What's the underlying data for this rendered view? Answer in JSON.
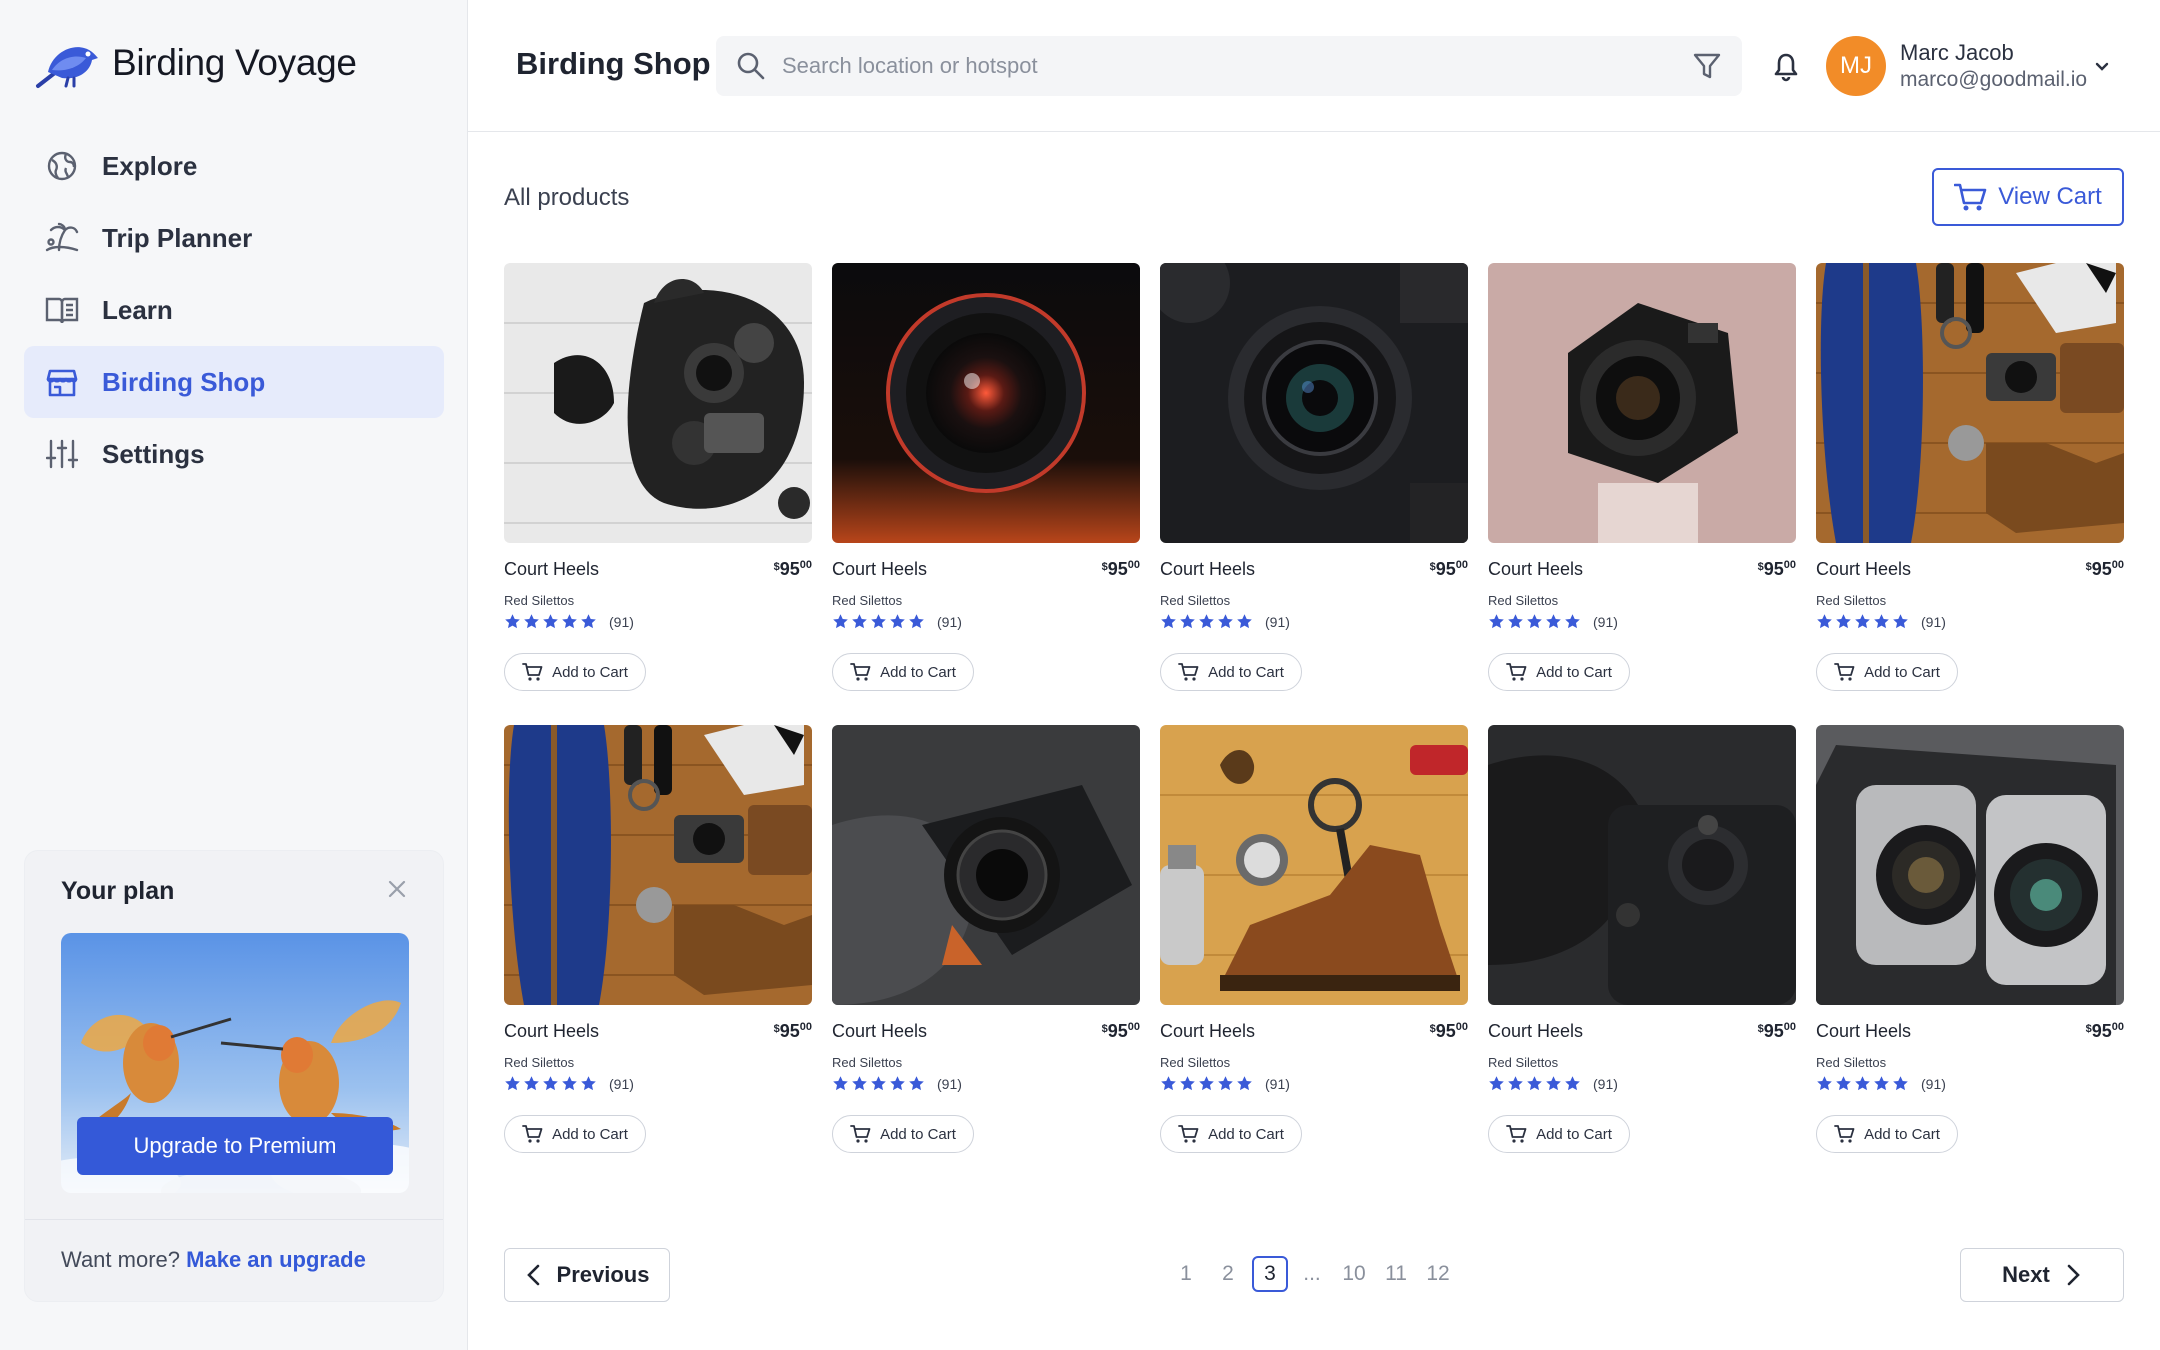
{
  "app": {
    "name": "Birding Voyage"
  },
  "sidebar": {
    "items": [
      {
        "label": "Explore",
        "icon": "globe-icon",
        "active": false
      },
      {
        "label": "Trip Planner",
        "icon": "island-icon",
        "active": false
      },
      {
        "label": "Learn",
        "icon": "book-icon",
        "active": false
      },
      {
        "label": "Birding Shop",
        "icon": "store-icon",
        "active": true
      },
      {
        "label": "Settings",
        "icon": "sliders-icon",
        "active": false
      }
    ],
    "plan": {
      "title": "Your plan",
      "upgrade_label": "Upgrade to  Premium",
      "more_text": "Want more?",
      "more_link": "Make an upgrade"
    }
  },
  "header": {
    "title": "Birding Shop",
    "search_placeholder": "Search location or hotspot",
    "user": {
      "initials": "MJ",
      "name": "Marc Jacob",
      "email": "marco@goodmail.io"
    }
  },
  "main": {
    "section_label": "All products",
    "view_cart_label": "View Cart",
    "products": [
      {
        "name": "Court Heels",
        "brand": "Red Silettos",
        "price_main": "95",
        "price_cents": "00",
        "reviews": "(91)",
        "rating": 5,
        "add_label": "Add to Cart",
        "photo": "camera-bag"
      },
      {
        "name": "Court Heels",
        "brand": "Red Silettos",
        "price_main": "95",
        "price_cents": "00",
        "reviews": "(91)",
        "rating": 5,
        "add_label": "Add to Cart",
        "photo": "lens-red"
      },
      {
        "name": "Court Heels",
        "brand": "Red Silettos",
        "price_main": "95",
        "price_cents": "00",
        "reviews": "(91)",
        "rating": 5,
        "add_label": "Add to Cart",
        "photo": "lens-dark"
      },
      {
        "name": "Court Heels",
        "brand": "Red Silettos",
        "price_main": "95",
        "price_cents": "00",
        "reviews": "(91)",
        "rating": 5,
        "add_label": "Add to Cart",
        "photo": "camera-pink"
      },
      {
        "name": "Court Heels",
        "brand": "Red Silettos",
        "price_main": "95",
        "price_cents": "00",
        "reviews": "(91)",
        "rating": 5,
        "add_label": "Add to Cart",
        "photo": "flatlay"
      },
      {
        "name": "Court Heels",
        "brand": "Red Silettos",
        "price_main": "95",
        "price_cents": "00",
        "reviews": "(91)",
        "rating": 5,
        "add_label": "Add to Cart",
        "photo": "flatlay"
      },
      {
        "name": "Court Heels",
        "brand": "Red Silettos",
        "price_main": "95",
        "price_cents": "00",
        "reviews": "(91)",
        "rating": 5,
        "add_label": "Add to Cart",
        "photo": "camera-in-bag"
      },
      {
        "name": "Court Heels",
        "brand": "Red Silettos",
        "price_main": "95",
        "price_cents": "00",
        "reviews": "(91)",
        "rating": 5,
        "add_label": "Add to Cart",
        "photo": "boot-wood"
      },
      {
        "name": "Court Heels",
        "brand": "Red Silettos",
        "price_main": "95",
        "price_cents": "00",
        "reviews": "(91)",
        "rating": 5,
        "add_label": "Add to Cart",
        "photo": "camera-black"
      },
      {
        "name": "Court Heels",
        "brand": "Red Silettos",
        "price_main": "95",
        "price_cents": "00",
        "reviews": "(91)",
        "rating": 5,
        "add_label": "Add to Cart",
        "photo": "lens-bag"
      }
    ]
  },
  "pagination": {
    "prev_label": "Previous",
    "next_label": "Next",
    "pages": [
      "1",
      "2",
      "3",
      "...",
      "10",
      "11",
      "12"
    ],
    "current": "3"
  },
  "colors": {
    "accent": "#3a5ad8",
    "avatar": "#f28c28",
    "star": "#3a5ad8"
  }
}
